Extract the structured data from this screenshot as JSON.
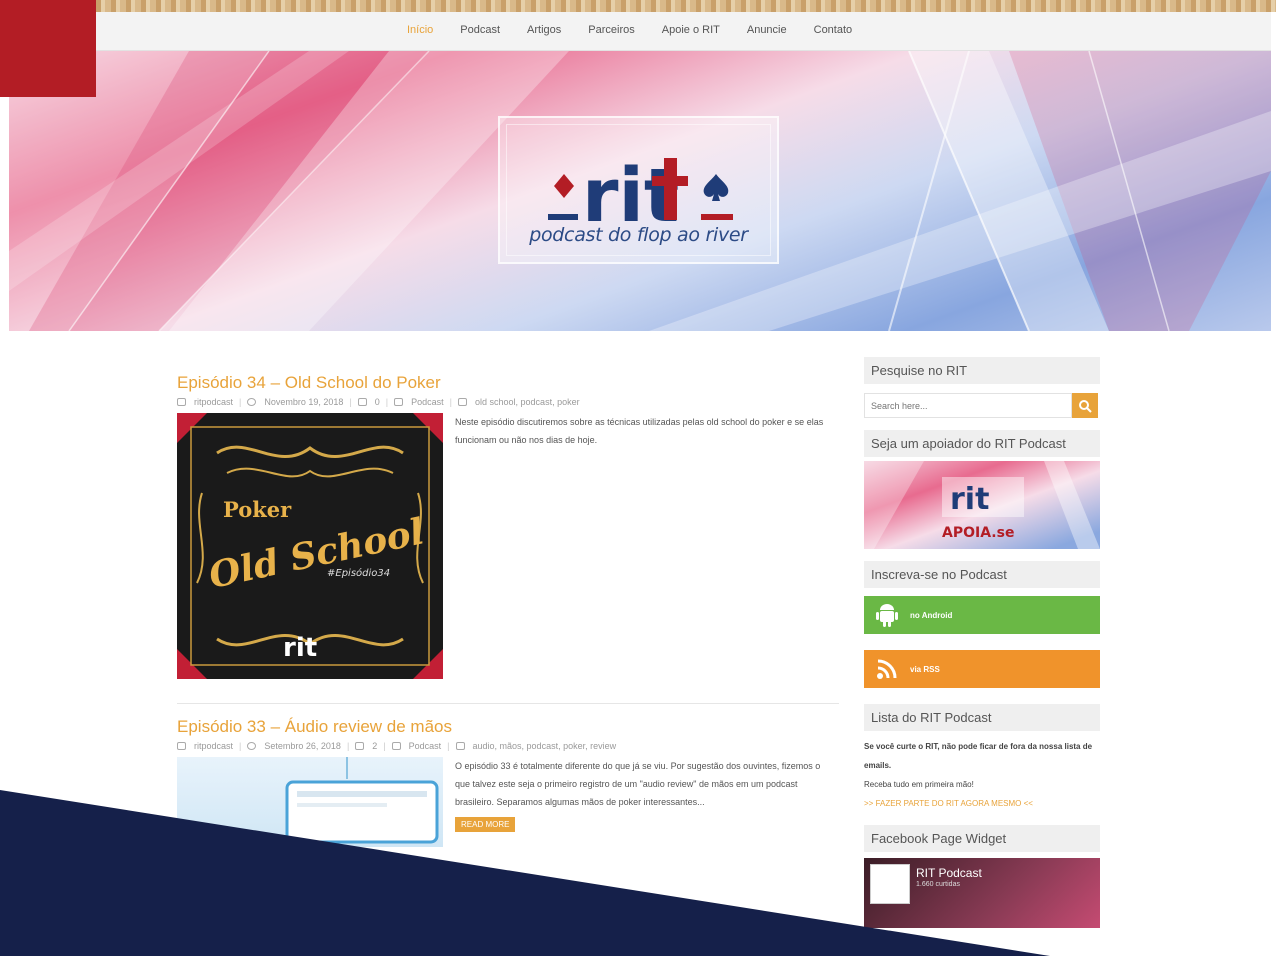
{
  "nav": {
    "items": [
      {
        "label": "Início",
        "active": true
      },
      {
        "label": "Podcast",
        "active": false
      },
      {
        "label": "Artigos",
        "active": false
      },
      {
        "label": "Parceiros",
        "active": false
      },
      {
        "label": "Apoie o RIT",
        "active": false
      },
      {
        "label": "Anuncie",
        "active": false
      },
      {
        "label": "Contato",
        "active": false
      }
    ]
  },
  "hero": {
    "logo_text": "rit",
    "tagline": "podcast do flop ao river"
  },
  "posts": [
    {
      "title": "Episódio 34 – Old School do Poker",
      "author": "ritpodcast",
      "date": "Novembro 19, 2018",
      "comments": "0",
      "category": "Podcast",
      "tags": "old school, podcast, poker",
      "excerpt": "Neste episódio discutiremos sobre as técnicas utilizadas pelas old school do poker e se elas funcionam ou não nos dias de hoje.",
      "thumb": {
        "line1": "Poker",
        "line2": "Old School",
        "hashtag": "#Episódio34",
        "brand": "rit"
      }
    },
    {
      "title": "Episódio 33 – Áudio review de mãos",
      "author": "ritpodcast",
      "date": "Setembro 26, 2018",
      "comments": "2",
      "category": "Podcast",
      "tags": "audio, mãos, podcast, poker, review",
      "excerpt": "O episódio 33 é totalmente diferente do que já se viu. Por sugestão dos ouvintes, fizemos o que talvez este seja o primeiro registro de um \"audio review\" de mãos em um podcast brasileiro. Separamos algumas mãos de poker interessantes...",
      "read_more": "READ MORE"
    }
  ],
  "sidebar": {
    "search": {
      "title": "Pesquise no RIT",
      "placeholder": "Search here..."
    },
    "support": {
      "title": "Seja um apoiador do RIT Podcast",
      "banner_logo": "rit",
      "banner_text": "APOIA.se"
    },
    "subscribe": {
      "title": "Inscreva-se no Podcast",
      "android_label": "no Android",
      "rss_label": "via RSS"
    },
    "list": {
      "title": "Lista do RIT Podcast",
      "text1": "Se você curte o RIT, não pode ficar de fora da nossa lista de emails.",
      "text2": "Receba tudo em primeira mão!",
      "link": ">> FAZER PARTE DO RIT AGORA MESMO <<"
    },
    "facebook": {
      "title": "Facebook Page Widget",
      "page_name": "RIT Podcast",
      "likes": "1.660 curtidas"
    }
  },
  "colors": {
    "accent": "#e8a33a",
    "brand_red": "#b31d25",
    "brand_blue": "#1f3c78",
    "navy": "#15204a",
    "android_green": "#6ab845",
    "rss_orange": "#f0932b"
  }
}
